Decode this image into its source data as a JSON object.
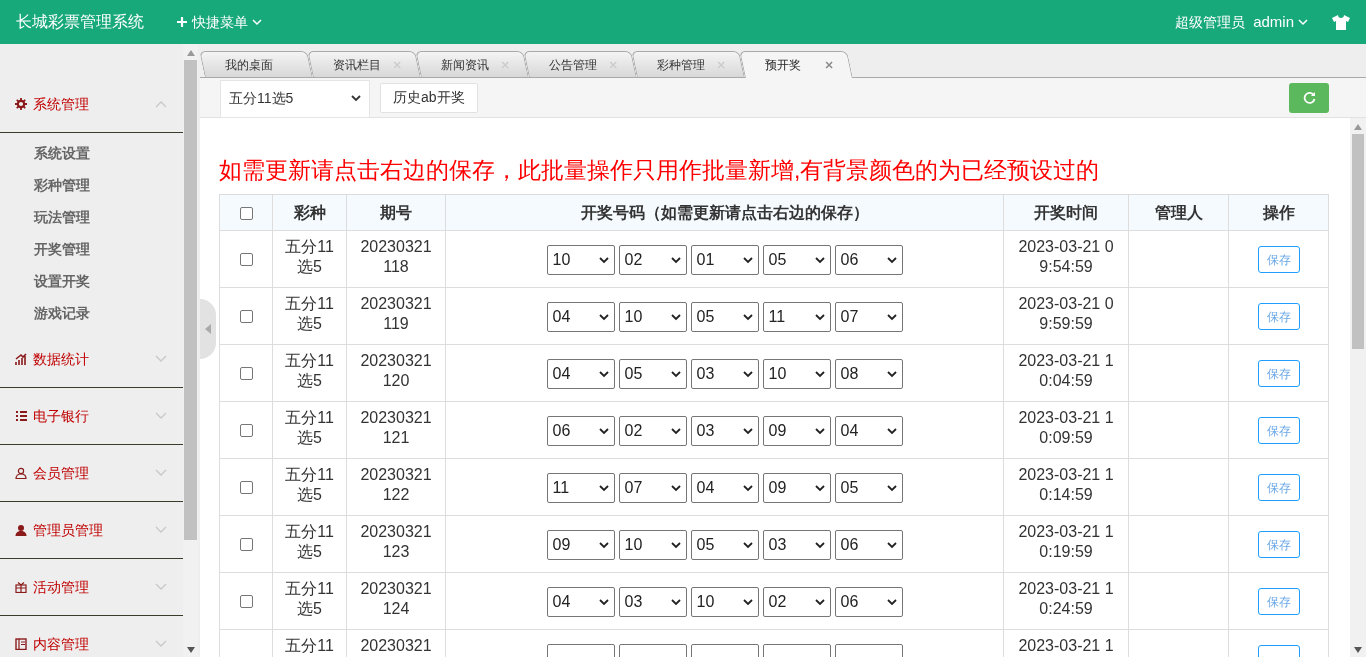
{
  "header": {
    "title": "长城彩票管理系统",
    "quick_menu": "快捷菜单",
    "role": "超级管理员",
    "username": "admin"
  },
  "sidebar": {
    "menus": [
      {
        "label": "系统管理",
        "expanded": true,
        "children": [
          {
            "label": "系统设置"
          },
          {
            "label": "彩种管理"
          },
          {
            "label": "玩法管理"
          },
          {
            "label": "开奖管理"
          },
          {
            "label": "设置开奖"
          },
          {
            "label": "游戏记录"
          }
        ]
      },
      {
        "label": "数据统计",
        "expanded": false
      },
      {
        "label": "电子银行",
        "expanded": false
      },
      {
        "label": "会员管理",
        "expanded": false
      },
      {
        "label": "管理员管理",
        "expanded": false
      },
      {
        "label": "活动管理",
        "expanded": false
      },
      {
        "label": "内容管理",
        "expanded": false
      }
    ]
  },
  "tabs": [
    {
      "label": "我的桌面",
      "closable": false,
      "selected": false
    },
    {
      "label": "资讯栏目",
      "closable": true,
      "selected": false
    },
    {
      "label": "新闻资讯",
      "closable": true,
      "selected": false
    },
    {
      "label": "公告管理",
      "closable": true,
      "selected": false
    },
    {
      "label": "彩种管理",
      "closable": true,
      "selected": false
    },
    {
      "label": "预开奖",
      "closable": true,
      "selected": true
    }
  ],
  "toolbar": {
    "lottery_select": "五分11选5",
    "history_button": "历史ab开奖"
  },
  "notice": "如需更新请点击右边的保存，此批量操作只用作批量新增,有背景颜色的为已经预设过的",
  "table": {
    "columns": [
      "彩种",
      "期号",
      "开奖号码（如需更新请点击右边的保存）",
      "开奖时间",
      "管理人",
      "操作"
    ],
    "rows": [
      {
        "checked": false,
        "lottery": "五分11选5",
        "issue": "20230321118",
        "numbers": [
          "10",
          "02",
          "01",
          "05",
          "06"
        ],
        "time": "2023-03-21 09:54:59",
        "save": "保存"
      },
      {
        "checked": false,
        "lottery": "五分11选5",
        "issue": "20230321119",
        "numbers": [
          "04",
          "10",
          "05",
          "11",
          "07"
        ],
        "time": "2023-03-21 09:59:59",
        "save": "保存"
      },
      {
        "checked": false,
        "lottery": "五分11选5",
        "issue": "20230321120",
        "numbers": [
          "04",
          "05",
          "03",
          "10",
          "08"
        ],
        "time": "2023-03-21 10:04:59",
        "save": "保存"
      },
      {
        "checked": false,
        "lottery": "五分11选5",
        "issue": "20230321121",
        "numbers": [
          "06",
          "02",
          "03",
          "09",
          "04"
        ],
        "time": "2023-03-21 10:09:59",
        "save": "保存"
      },
      {
        "checked": false,
        "lottery": "五分11选5",
        "issue": "20230321122",
        "numbers": [
          "11",
          "07",
          "04",
          "09",
          "05"
        ],
        "time": "2023-03-21 10:14:59",
        "save": "保存"
      },
      {
        "checked": false,
        "lottery": "五分11选5",
        "issue": "20230321123",
        "numbers": [
          "09",
          "10",
          "05",
          "03",
          "06"
        ],
        "time": "2023-03-21 10:19:59",
        "save": "保存"
      },
      {
        "checked": false,
        "lottery": "五分11选5",
        "issue": "20230321124",
        "numbers": [
          "04",
          "03",
          "10",
          "02",
          "06"
        ],
        "time": "2023-03-21 10:24:59",
        "save": "保存"
      },
      {
        "lottery": "五分11",
        "issue": "20230321",
        "time": "2023-03-21 1"
      }
    ],
    "select_all": {
      "checked": false
    }
  }
}
